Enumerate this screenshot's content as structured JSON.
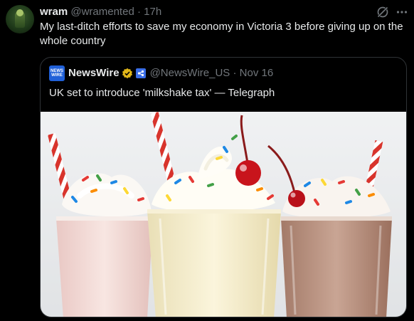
{
  "tweet": {
    "author_name": "wram",
    "author_handle": "@wramented",
    "separator": "·",
    "time": "17h",
    "text": "My last-ditch efforts to save my economy in Victoria 3 before giving up on the whole country",
    "icons": [
      "grok-icon",
      "more-icon"
    ]
  },
  "quote": {
    "avatar_text_top": "NEWS",
    "avatar_text_bottom": "WIRE",
    "name": "NewsWire",
    "handle": "@NewsWire_US",
    "separator": "·",
    "date": "Nov 16",
    "text": "UK set to introduce 'milkshake tax' — Telegraph",
    "media": {
      "description_icon": "milkshake-photo",
      "colors": {
        "left_glass": "#f3d9d6",
        "middle_glass": "#f6efcc",
        "right_glass": "#b98d7a",
        "straw": "#d8342c",
        "cherry": "#c8141c"
      }
    }
  },
  "colors": {
    "background": "#000000",
    "text": "#e7e9ea",
    "muted": "#71767b",
    "border": "#2f3336",
    "verified_gold": "#e2b719",
    "affiliate_blue": "#3a6ee8"
  }
}
